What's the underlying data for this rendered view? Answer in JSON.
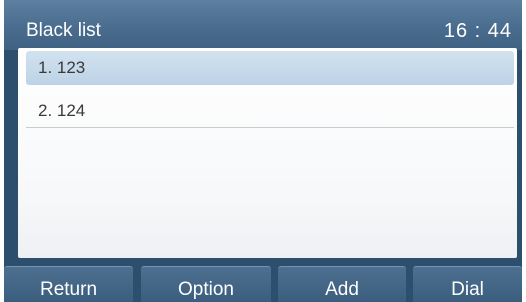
{
  "header": {
    "title": "Black list",
    "time": "16 : 44"
  },
  "list": {
    "items": [
      {
        "label": "1. 123",
        "selected": true
      },
      {
        "label": "2. 124",
        "selected": false
      }
    ]
  },
  "softkeys": {
    "return_label": "Return",
    "option_label": "Option",
    "add_label": "Add",
    "dial_label": "Dial"
  }
}
